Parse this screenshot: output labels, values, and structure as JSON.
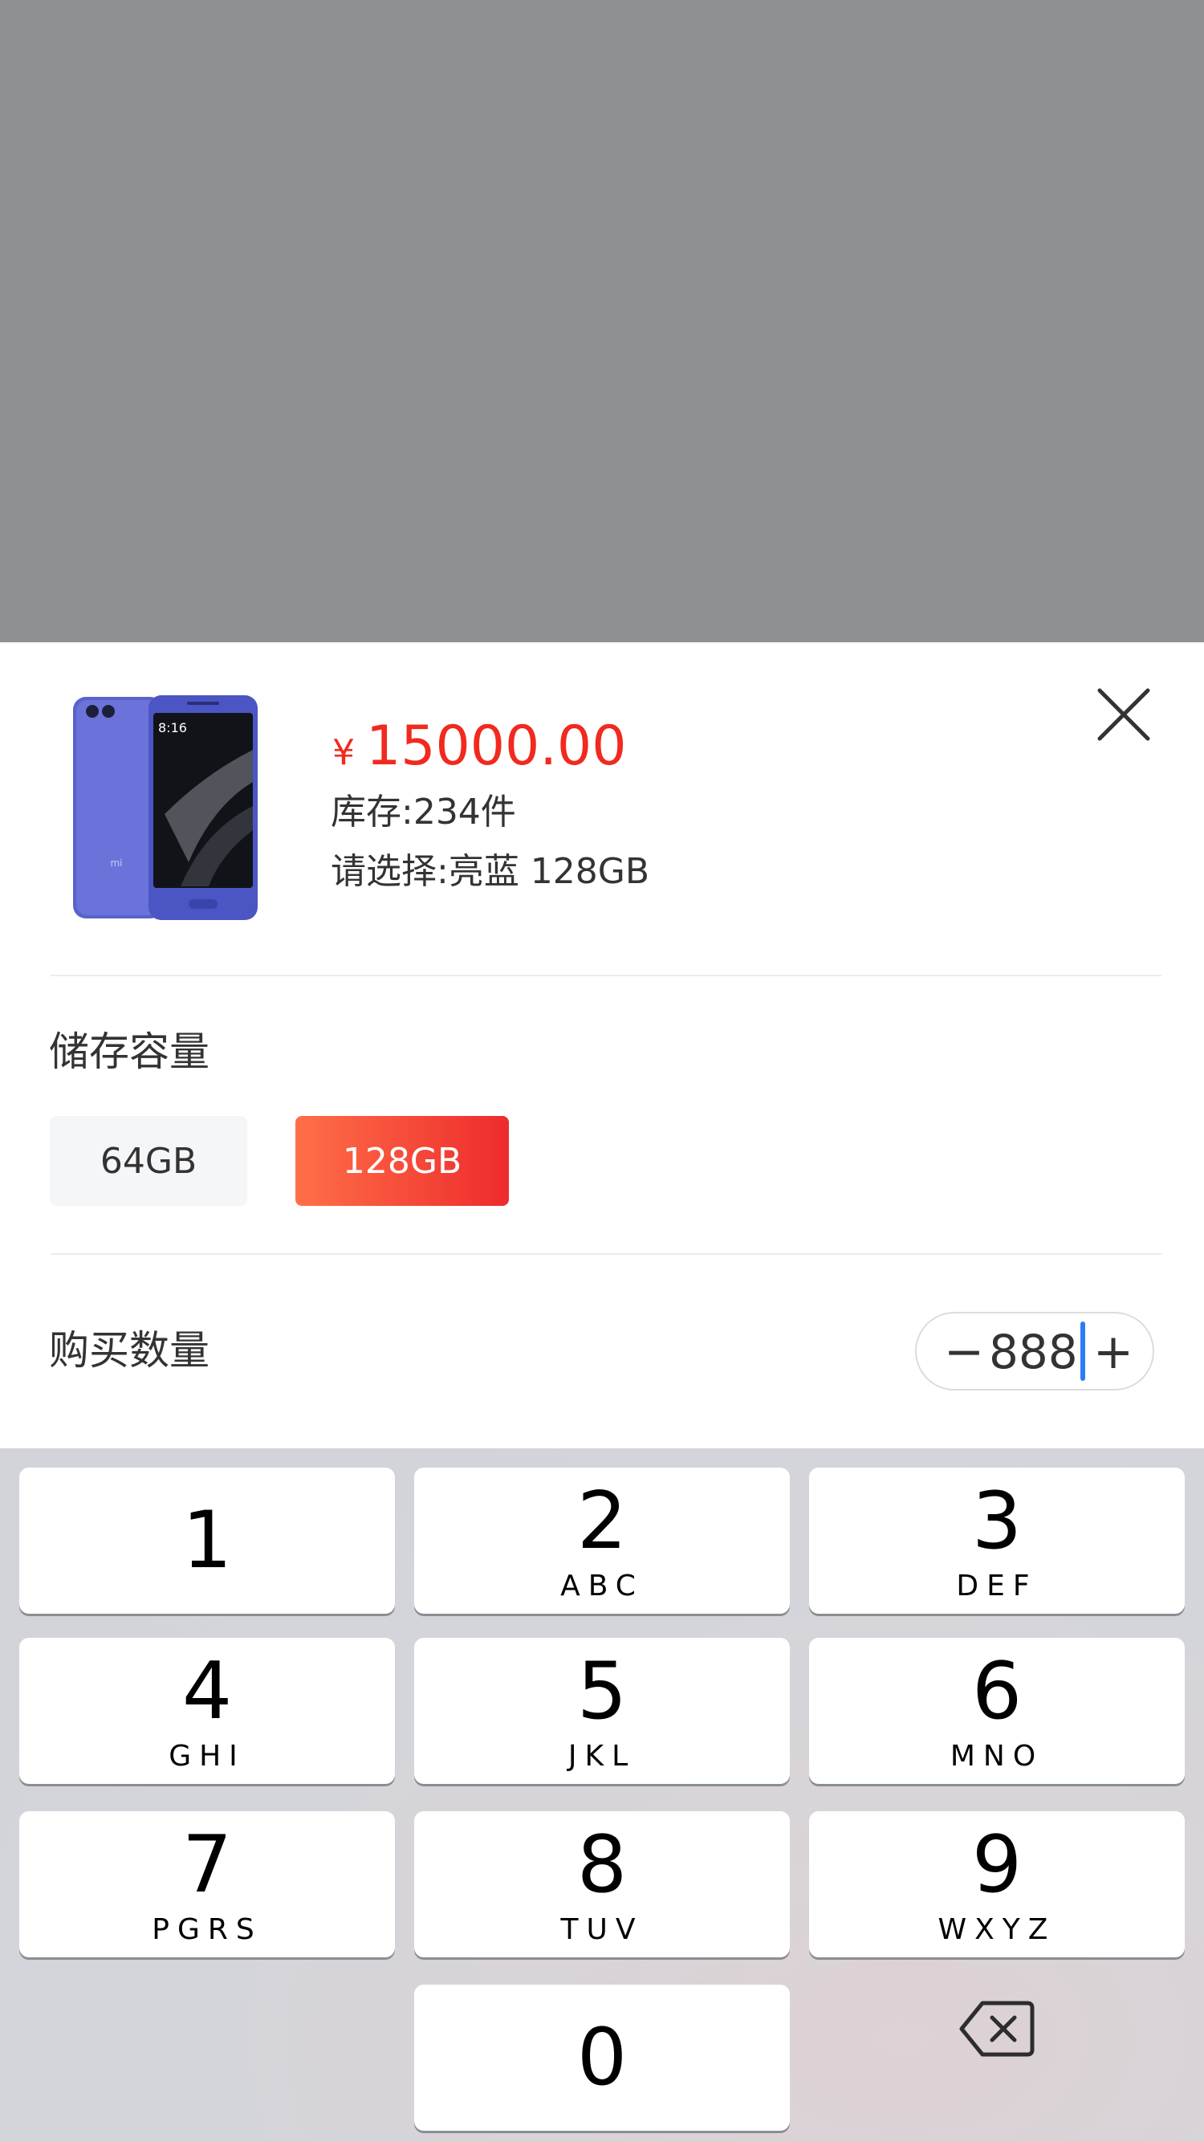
{
  "product": {
    "currency": "¥",
    "price": "15000.00",
    "stock": "库存:234件",
    "selected": "请选择:亮蓝 128GB",
    "image": "phone-product-image"
  },
  "storage": {
    "title": "储存容量",
    "options": [
      {
        "label": "64GB",
        "selected": false
      },
      {
        "label": "128GB",
        "selected": true
      }
    ]
  },
  "quantity": {
    "title": "购买数量",
    "minus": "−",
    "value": "888",
    "plus": "+"
  },
  "keypad": {
    "keys": [
      {
        "digit": "1",
        "letters": ""
      },
      {
        "digit": "2",
        "letters": "ABC"
      },
      {
        "digit": "3",
        "letters": "DEF"
      },
      {
        "digit": "4",
        "letters": "GHI"
      },
      {
        "digit": "5",
        "letters": "JKL"
      },
      {
        "digit": "6",
        "letters": "MNO"
      },
      {
        "digit": "7",
        "letters": "PGRS"
      },
      {
        "digit": "8",
        "letters": "TUV"
      },
      {
        "digit": "9",
        "letters": "WXYZ"
      },
      {
        "digit": "0",
        "letters": ""
      }
    ],
    "backspace_icon": "backspace-icon"
  },
  "colors": {
    "accent": "#f1291f",
    "gradient_start": "#ff6f48",
    "gradient_end": "#ee2b2d",
    "caret": "#2f7bf5",
    "overlay": "#8f9092"
  }
}
